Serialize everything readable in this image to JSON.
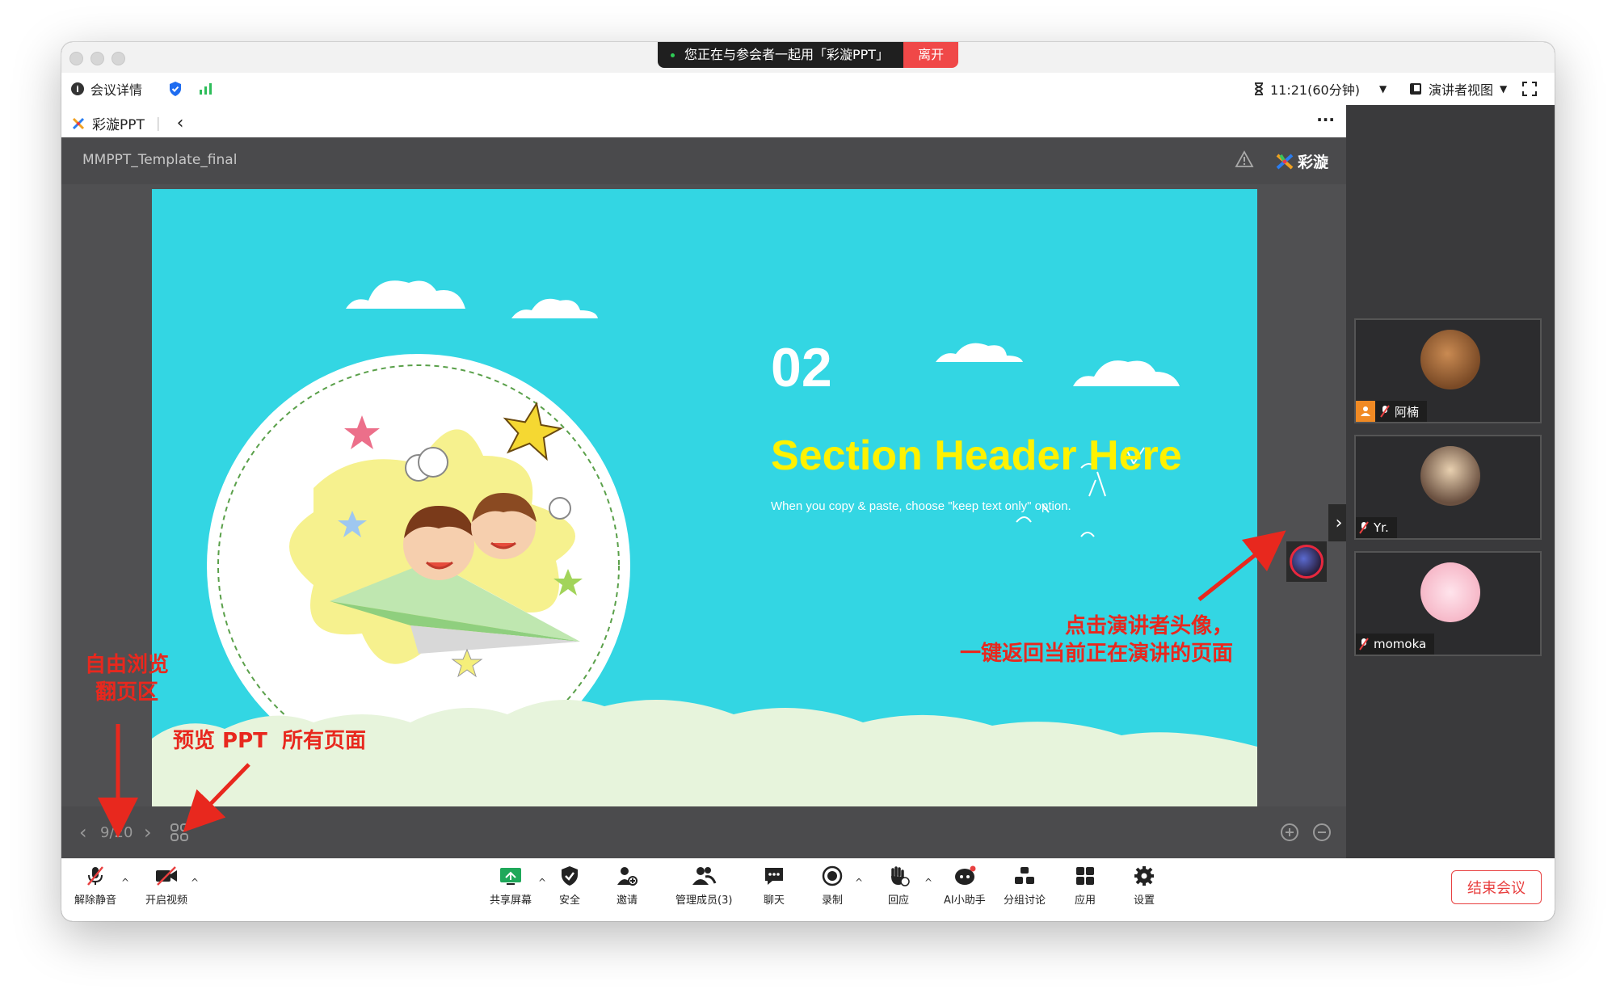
{
  "top_banner": {
    "sharing_text": "您正在与参会者一起用「彩漩PPT」",
    "leave_label": "离开"
  },
  "info_bar": {
    "meeting_details": "会议详情",
    "timer": "11:21(60分钟)",
    "view_mode": "演讲者视图"
  },
  "app_bar": {
    "app_name": "彩漩PPT",
    "more": "···"
  },
  "doc_bar": {
    "filename": "MMPPT_Template_final",
    "brand": "彩漩"
  },
  "slide": {
    "number": "02",
    "header": "Section Header Here",
    "subtitle": "When you copy & paste, choose \"keep text only\" option."
  },
  "nav": {
    "page_indicator": "9/20",
    "prev": "‹",
    "next": "›"
  },
  "participants": [
    {
      "name": "阿楠"
    },
    {
      "name": "Yr."
    },
    {
      "name": "momoka"
    }
  ],
  "toolbar": {
    "unmute": "解除静音",
    "start_video": "开启视频",
    "share_screen": "共享屏幕",
    "security": "安全",
    "invite": "邀请",
    "manage_members": "管理成员(3)",
    "chat": "聊天",
    "record": "录制",
    "reactions": "回应",
    "ai_assistant": "AI小助手",
    "breakout": "分组讨论",
    "apps": "应用",
    "settings": "设置",
    "end_meeting": "结束会议"
  },
  "annotations": {
    "free_browse_line1": "自由浏览",
    "free_browse_line2": "翻页区",
    "preview_all": "预览 PPT  所有页面",
    "presenter_line1": "点击演讲者头像，",
    "presenter_line2": "一键返回当前正在演讲的页面"
  },
  "colors": {
    "slide_bg": "#33d6e3",
    "header_yellow": "#fff200",
    "annotation_red": "#e8281e",
    "end_red": "#e84040"
  }
}
